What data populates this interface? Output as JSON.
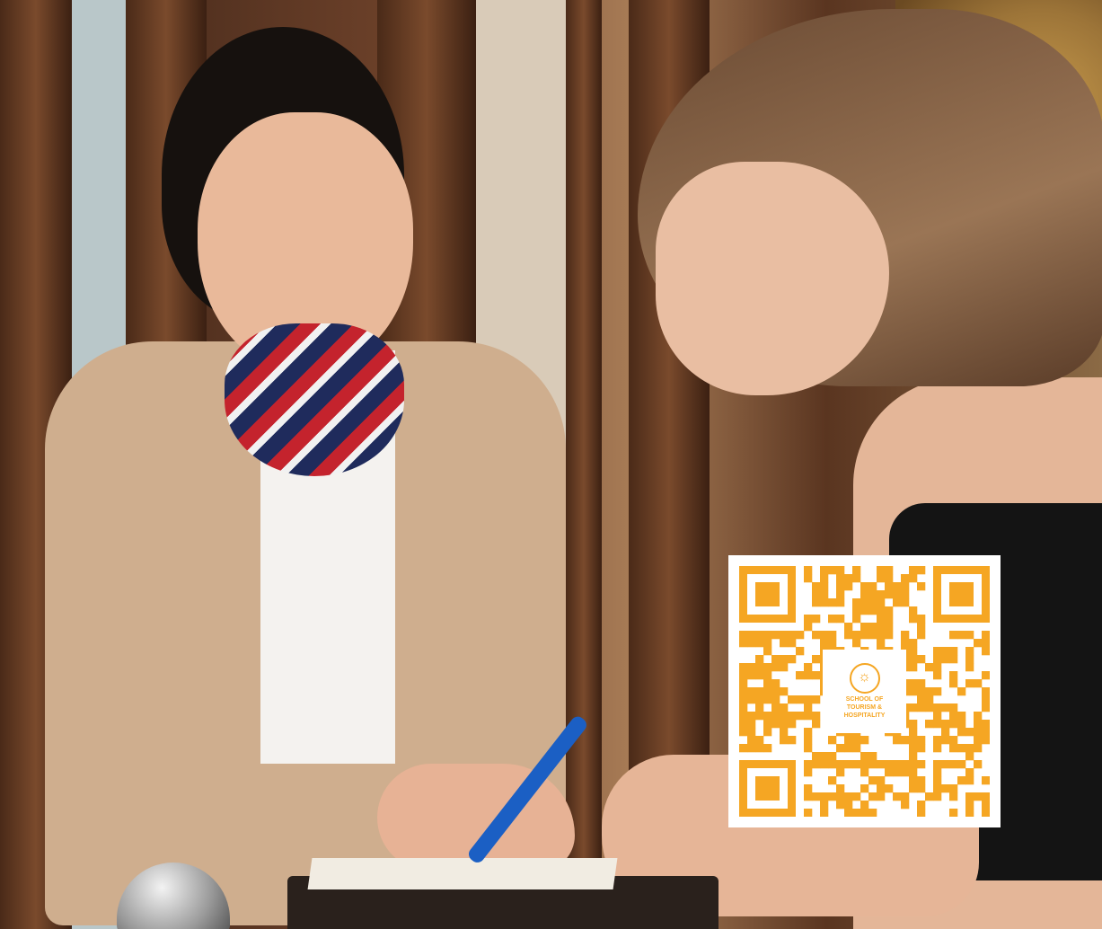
{
  "qr_code": {
    "logo_text": "SCHOOL OF\nTOURISM &\nHOSPITALITY",
    "color": "#f5a623"
  },
  "colors": {
    "qr_orange": "#f5a623",
    "scarf_navy": "#1f2b5c",
    "scarf_red": "#c4232d",
    "blazer_beige": "#cfae8e",
    "pen_blue": "#1b5fc4"
  }
}
